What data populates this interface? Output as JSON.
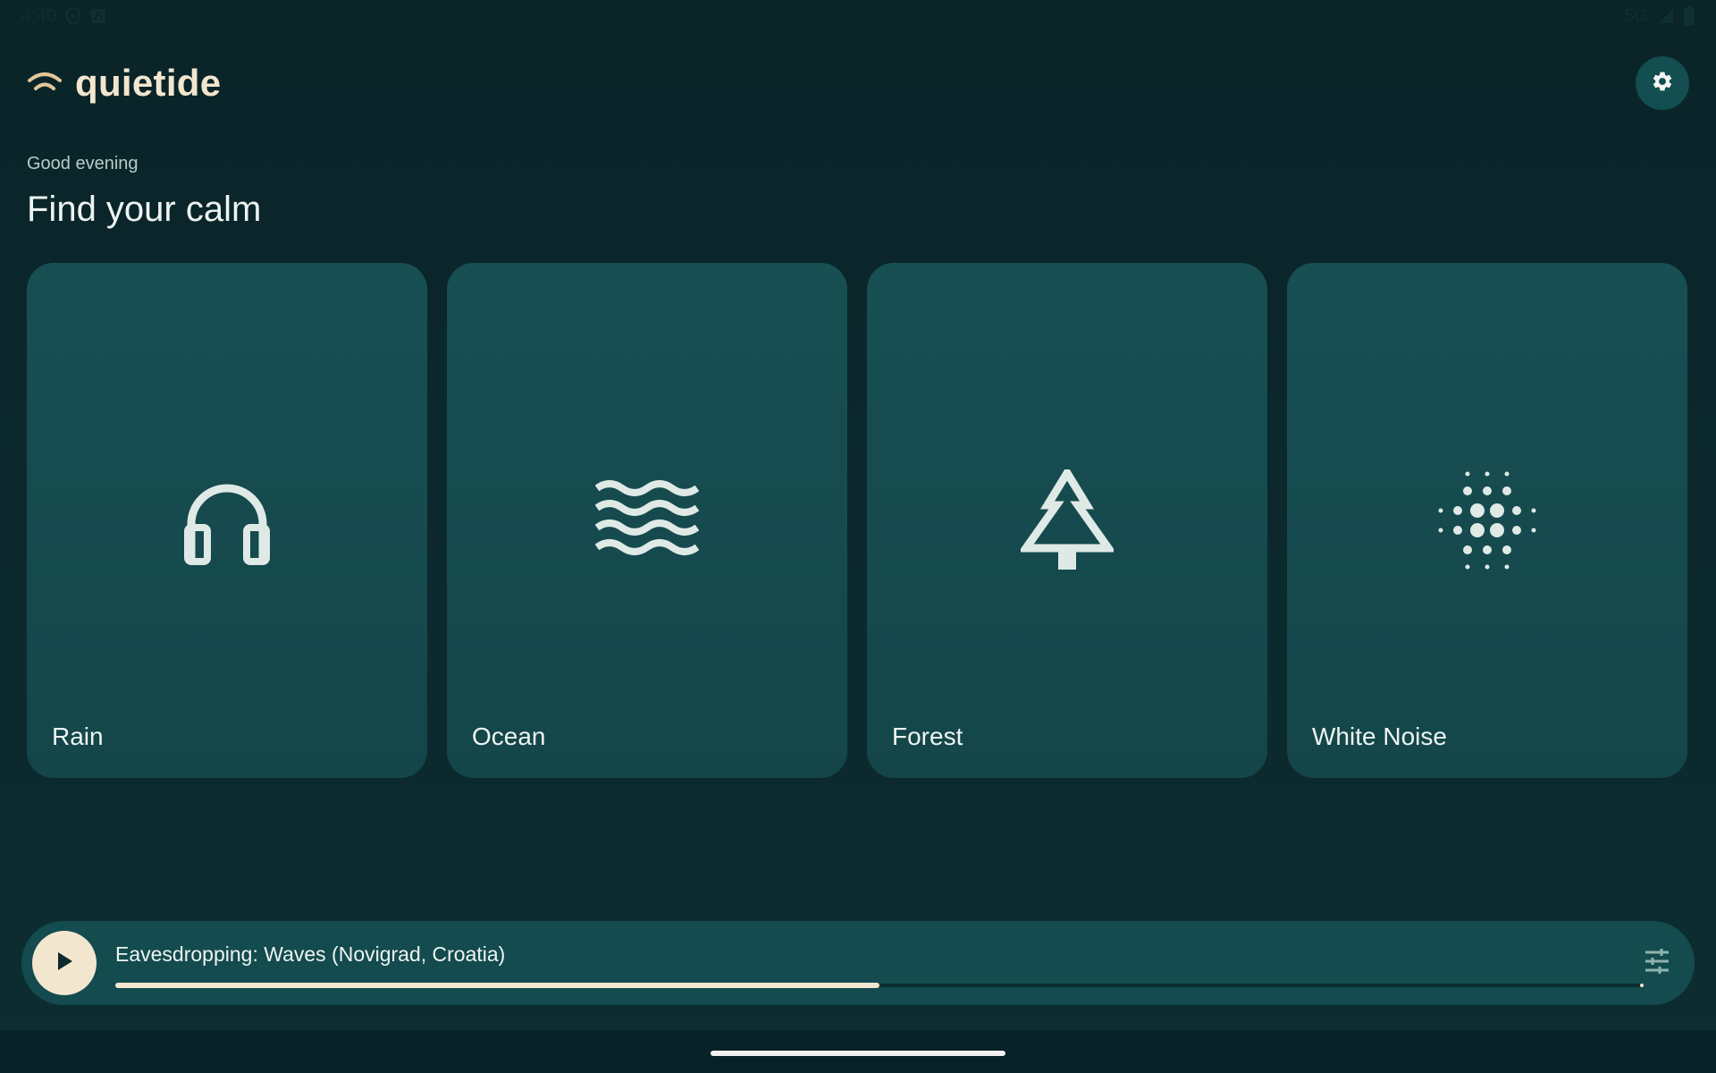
{
  "status_bar": {
    "time": "4:40",
    "network": "5G",
    "icons": [
      "vpn-shield-icon",
      "app-notification-icon",
      "signal-icon",
      "battery-icon"
    ]
  },
  "app": {
    "name": "quietide",
    "logo_icon": "sound-arc-icon",
    "accent_color": "#f3e6cf"
  },
  "header": {
    "greeting": "Good evening",
    "headline": "Find your calm",
    "settings_icon": "gear-icon"
  },
  "sounds": [
    {
      "label": "Rain",
      "icon": "headphones-icon"
    },
    {
      "label": "Ocean",
      "icon": "waves-icon"
    },
    {
      "label": "Forest",
      "icon": "pine-tree-icon"
    },
    {
      "label": "White Noise",
      "icon": "dot-grid-noise-icon"
    }
  ],
  "player": {
    "track_title": "Eavesdropping: Waves (Novigrad, Croatia)",
    "progress": 0.5,
    "play_icon": "play-icon",
    "mixer_icon": "tune-sliders-icon"
  }
}
